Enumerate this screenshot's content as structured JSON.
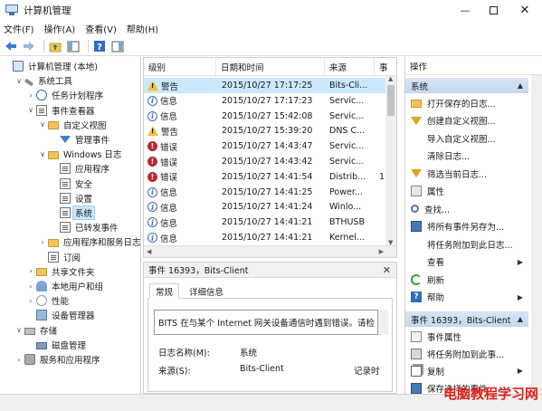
{
  "window": {
    "title": "计算机管理",
    "minimize_glyph": "—",
    "close_glyph": "✕"
  },
  "menu": [
    "文件(F)",
    "操作(A)",
    "查看(V)",
    "帮助(H)"
  ],
  "tree": {
    "items": [
      {
        "label": "计算机管理 (本地)",
        "icon": "computer-icon",
        "expander": "",
        "level": 0
      },
      {
        "label": "系统工具",
        "icon": "tools-icon",
        "expander": "∨",
        "level": 1
      },
      {
        "label": "任务计划程序",
        "icon": "clock-icon",
        "expander": "›",
        "level": 2
      },
      {
        "label": "事件查看器",
        "icon": "event-viewer-icon",
        "expander": "∨",
        "level": 2
      },
      {
        "label": "自定义视图",
        "icon": "folder-icon",
        "expander": "∨",
        "level": 3
      },
      {
        "label": "管理事件",
        "icon": "filter-icon",
        "expander": "",
        "level": 4
      },
      {
        "label": "Windows 日志",
        "icon": "folder-icon",
        "expander": "∨",
        "level": 3
      },
      {
        "label": "应用程序",
        "icon": "log-icon",
        "expander": "",
        "level": 4
      },
      {
        "label": "安全",
        "icon": "log-icon",
        "expander": "",
        "level": 4
      },
      {
        "label": "设置",
        "icon": "log-icon",
        "expander": "",
        "level": 4
      },
      {
        "label": "系统",
        "icon": "log-icon",
        "expander": "",
        "level": 4,
        "selected": true
      },
      {
        "label": "已转发事件",
        "icon": "log-icon",
        "expander": "",
        "level": 4
      },
      {
        "label": "应用程序和服务日志",
        "icon": "folder-icon",
        "expander": "›",
        "level": 3
      },
      {
        "label": "订阅",
        "icon": "log-icon",
        "expander": "",
        "level": 3
      },
      {
        "label": "共享文件夹",
        "icon": "share-icon",
        "expander": "›",
        "level": 2
      },
      {
        "label": "本地用户和组",
        "icon": "users-icon",
        "expander": "›",
        "level": 2
      },
      {
        "label": "性能",
        "icon": "performance-icon",
        "expander": "›",
        "level": 2
      },
      {
        "label": "设备管理器",
        "icon": "device-icon",
        "expander": "",
        "level": 2
      },
      {
        "label": "存储",
        "icon": "storage-icon",
        "expander": "∨",
        "level": 1
      },
      {
        "label": "磁盘管理",
        "icon": "disk-icon",
        "expander": "",
        "level": 2
      },
      {
        "label": "服务和应用程序",
        "icon": "services-icon",
        "expander": "›",
        "level": 1
      }
    ]
  },
  "events": {
    "columns": [
      "级别",
      "日期和时间",
      "来源",
      "事"
    ],
    "rows": [
      {
        "level": "警告",
        "kind": "warning",
        "datetime": "2015/10/27 17:17:25",
        "source": "Bits-Cli...",
        "extra": "",
        "selected": true
      },
      {
        "level": "信息",
        "kind": "info",
        "datetime": "2015/10/27 17:17:23",
        "source": "Servic...",
        "extra": ""
      },
      {
        "level": "信息",
        "kind": "info",
        "datetime": "2015/10/27 15:42:08",
        "source": "Servic...",
        "extra": ""
      },
      {
        "level": "警告",
        "kind": "warning",
        "datetime": "2015/10/27 15:39:20",
        "source": "DNS C...",
        "extra": ""
      },
      {
        "level": "错误",
        "kind": "error",
        "datetime": "2015/10/27 14:43:47",
        "source": "Servic...",
        "extra": ""
      },
      {
        "level": "错误",
        "kind": "error",
        "datetime": "2015/10/27 14:43:42",
        "source": "Servic...",
        "extra": ""
      },
      {
        "level": "错误",
        "kind": "error",
        "datetime": "2015/10/27 14:41:54",
        "source": "Distrib...",
        "extra": "1"
      },
      {
        "level": "信息",
        "kind": "info",
        "datetime": "2015/10/27 14:41:25",
        "source": "Power...",
        "extra": ""
      },
      {
        "level": "信息",
        "kind": "info",
        "datetime": "2015/10/27 14:41:24",
        "source": "Winlo...",
        "extra": ""
      },
      {
        "level": "信息",
        "kind": "info",
        "datetime": "2015/10/27 14:41:21",
        "source": "BTHUSB",
        "extra": ""
      },
      {
        "level": "信息",
        "kind": "info",
        "datetime": "2015/10/27 14:41:21",
        "source": "Kernel...",
        "extra": ""
      }
    ]
  },
  "detail": {
    "title": "事件 16393，Bits-Client",
    "close_glyph": "✕",
    "tabs": [
      "常规",
      "详细信息"
    ],
    "description": "BITS 在与某个 Internet 网关设备通信时遇到错误。请检",
    "log_name_label": "日志名称(M):",
    "log_name_value": "系统",
    "source_label": "来源(S):",
    "source_value": "Bits-Client",
    "logged_label": "记录时"
  },
  "actions": {
    "header": "操作",
    "section1": "系统",
    "items1": [
      {
        "label": "打开保存的日志...",
        "icon": "open-log-icon",
        "submenu": false
      },
      {
        "label": "创建自定义视图...",
        "icon": "filter-icon",
        "submenu": false
      },
      {
        "label": "导入自定义视图...",
        "icon": "",
        "submenu": false
      },
      {
        "label": "清除日志...",
        "icon": "",
        "submenu": false
      },
      {
        "label": "筛选当前日志...",
        "icon": "filter-icon",
        "submenu": false
      },
      {
        "label": "属性",
        "icon": "properties-icon",
        "submenu": false
      },
      {
        "label": "查找...",
        "icon": "find-icon",
        "submenu": false
      },
      {
        "label": "将所有事件另存为...",
        "icon": "save-icon",
        "submenu": false
      },
      {
        "label": "将任务附加到此日志...",
        "icon": "",
        "submenu": false
      },
      {
        "label": "查看",
        "icon": "",
        "submenu": true
      },
      {
        "label": "刷新",
        "icon": "refresh-icon",
        "submenu": false
      },
      {
        "label": "帮助",
        "icon": "help-icon",
        "submenu": true
      }
    ],
    "section2": "事件 16393，Bits-Client",
    "items2": [
      {
        "label": "事件属性",
        "icon": "event-properties-icon",
        "submenu": false
      },
      {
        "label": "将任务附加到此事...",
        "icon": "task-icon",
        "submenu": false
      },
      {
        "label": "复制",
        "icon": "copy-icon",
        "submenu": true
      },
      {
        "label": "保存选择的事件...",
        "icon": "save-selected-icon",
        "submenu": false
      }
    ]
  },
  "watermark": "电脑教程学习网",
  "colors": {
    "selection": "#cce8ff",
    "section_header": "#c4d8ef",
    "error": "#c0272d",
    "warning": "#f2c230",
    "info": "#3f6fb0",
    "watermark": "#e0201c"
  }
}
